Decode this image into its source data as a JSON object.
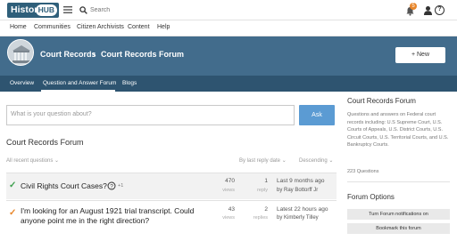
{
  "header": {
    "logo_text": "History",
    "logo_badge": "HUB",
    "search_placeholder": "Search",
    "notification_count": "5",
    "help_glyph": "?"
  },
  "nav": {
    "items": [
      "Home",
      "Communities",
      "Citizen Archivists",
      "Content",
      "Help"
    ]
  },
  "banner": {
    "breadcrumb_parent": "Court Records",
    "breadcrumb_separator": "›",
    "breadcrumb_current": "Court Records Forum",
    "new_button": "+ New"
  },
  "tabs": [
    "Overview",
    "Question and Answer Forum",
    "Blogs"
  ],
  "question_box": {
    "placeholder": "What is your question about?",
    "ask_label": "Ask"
  },
  "forum": {
    "title": "Court Records Forum",
    "filter_all": "All recent questions ⌄",
    "filter_sort": "By last reply date ⌄",
    "filter_order": "Descending ⌄"
  },
  "threads": [
    {
      "title": "Civil Rights Court Cases?",
      "extra": "+1",
      "views": "470",
      "views_label": "views",
      "replies": "1",
      "replies_label": "reply",
      "last_time": "Last 9 months ago",
      "last_by": "by Ray Bottorff Jr",
      "check_color": "#3ea04e"
    },
    {
      "title": "I'm looking for an August 1921 trial transcript. Could anyone point me in the right direction?",
      "views": "43",
      "views_label": "views",
      "replies": "2",
      "replies_label": "replies",
      "last_time": "Latest 22 hours ago",
      "last_by": "by Kimberly Tilley",
      "check_color": "#e8862a"
    }
  ],
  "sidebar": {
    "title": "Court Records Forum",
    "description": "Questions and answers on Federal court records including: U.S Supreme Court, U.S. Courts of Appeals, U.S. District Courts, U.S. Circuit Courts, U.S. Territorial Courts, and U.S. Bankruptcy Courts.",
    "count": "223 Questions",
    "options_title": "Forum Options",
    "button_notify": "Turn Forum notifications on",
    "button_bookmark": "Bookmark this forum"
  },
  "colors": {
    "banner": "#426c8c",
    "subtabs": "#2e5470",
    "ask_button": "#5b9bd3",
    "accent_orange": "#e8862a",
    "accent_green": "#3ea04e"
  }
}
